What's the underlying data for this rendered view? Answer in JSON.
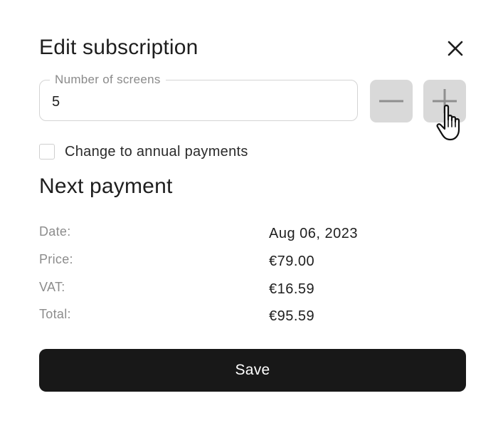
{
  "dialog": {
    "title": "Edit subscription",
    "close_icon": "close-icon"
  },
  "screens": {
    "label": "Number of screens",
    "value": "5",
    "decrement_icon": "minus-icon",
    "increment_icon": "plus-icon"
  },
  "annual": {
    "label": "Change to annual payments",
    "checked": false
  },
  "next_payment": {
    "title": "Next payment",
    "rows": [
      {
        "label": "Date:",
        "value": "Aug 06, 2023"
      },
      {
        "label": "Price:",
        "value": "€79.00"
      },
      {
        "label": "VAT:",
        "value": "€16.59"
      },
      {
        "label": "Total:",
        "value": "€95.59"
      }
    ]
  },
  "actions": {
    "save_label": "Save"
  },
  "colors": {
    "button_dark": "#181818",
    "stepper_bg": "#d9d9d9",
    "stepper_icon": "#8f8f8f",
    "muted_text": "#8c8c8c"
  }
}
